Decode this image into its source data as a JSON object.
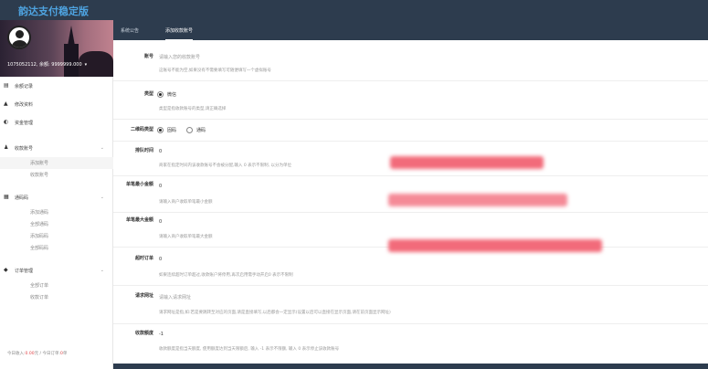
{
  "app": {
    "title": "韵达支付稳定版"
  },
  "profile": {
    "balance_text": "1075052112, 余额: 9999999.000",
    "chevron": "▾"
  },
  "sidebar": {
    "items": [
      {
        "label": "余额记录",
        "icon": "▤"
      },
      {
        "label": "修改资料",
        "icon": "▲"
      },
      {
        "label": "资金管理",
        "icon": "◐"
      },
      {
        "label": "收款账号",
        "icon": "♟",
        "children": [
          "添加账号",
          "收款账号"
        ]
      },
      {
        "label": "通码码",
        "icon": "▦",
        "children": [
          "添加通码",
          "全部通码",
          "添加码码",
          "全部码码"
        ]
      },
      {
        "label": "订单管理",
        "icon": "◆",
        "children": [
          "全部订单",
          "收款订单"
        ]
      }
    ],
    "stats": {
      "prefix": "今日收入:",
      "income": "0.00",
      "mid": "元 / 今日订单:",
      "orders": "0",
      "suffix": "单"
    }
  },
  "tabs": [
    {
      "label": "系统公告",
      "active": false
    },
    {
      "label": "添加收款账号",
      "active": true
    }
  ],
  "form": {
    "account": {
      "label": "账号",
      "placeholder": "请输入您的收款账号",
      "hint": "这账号不能为空,如果没有不需要填写可随便填写一个虚拟账号"
    },
    "type": {
      "label": "类型",
      "option": "微信",
      "hint": "类型是指收款账号的类型,请正确选择"
    },
    "qr_type": {
      "label": "二维码类型",
      "options": [
        "固码",
        "通码"
      ]
    },
    "rest_time": {
      "label": "排队时间",
      "value": "0",
      "hint": "商家在指定时间内该收款账号不会被分配,输入 0 表示不限制, 以分为单位"
    },
    "min_amount": {
      "label": "单笔最小金额",
      "value": "0",
      "hint": "请输入商户收取单笔最小金额"
    },
    "max_amount": {
      "label": "单笔最大金额",
      "value": "0",
      "hint": "请输入商户收取单笔最大金额"
    },
    "timeout_orders": {
      "label": "超时订单",
      "value": "0",
      "hint": "如果连续超时订单超过,收款账户将停用,再次启用需手动开启0 表示不限制"
    },
    "remark": {
      "label": "请求网址",
      "placeholder": "请输入请求网址",
      "hint": "请求网址是指,如:若是要跳转至对应的页面,请是直接填写,以后都会一定显示(设置以后可以直接在显示页面,请在前页面显示网址)"
    },
    "daily_limit": {
      "label": "收款额度",
      "value": "-1",
      "hint": "收款额度是指当天额度, 使用额度达到当天限额后, 输入 -1 表示不限额, 输入 0 表示停止该收款账号"
    }
  },
  "colors": {
    "header": "#2d3c4e",
    "brand": "#4ea3e0",
    "redacted": "#f26b7a"
  }
}
